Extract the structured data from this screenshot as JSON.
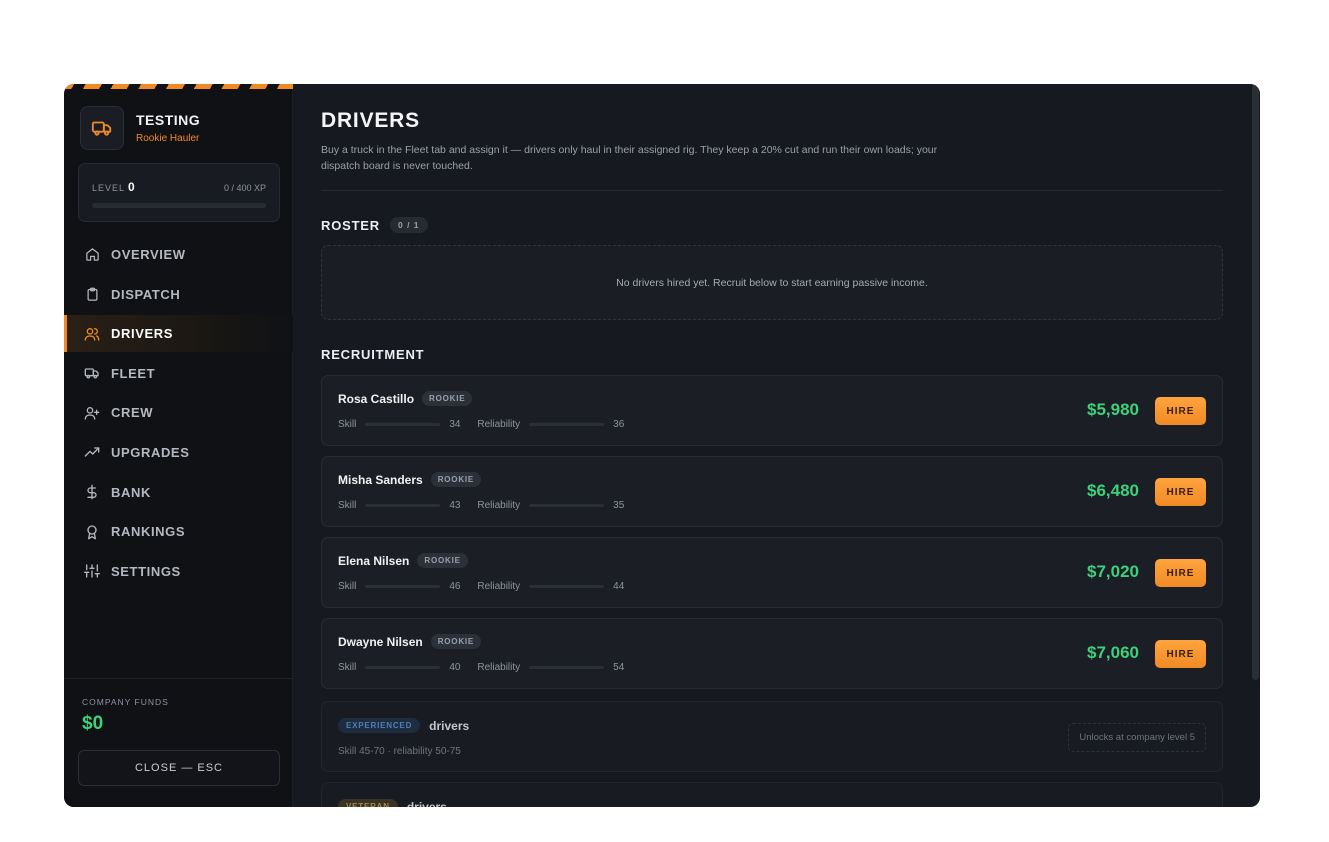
{
  "company": {
    "name": "TESTING",
    "rank": "Rookie Hauler"
  },
  "level": {
    "label": "LEVEL",
    "value": "0",
    "xp": "0 / 400 XP",
    "progress": 0
  },
  "nav": [
    {
      "label": "OVERVIEW",
      "icon": "home-icon",
      "active": false
    },
    {
      "label": "DISPATCH",
      "icon": "clipboard-icon",
      "active": false
    },
    {
      "label": "DRIVERS",
      "icon": "users-icon",
      "active": true
    },
    {
      "label": "FLEET",
      "icon": "truck-icon",
      "active": false
    },
    {
      "label": "CREW",
      "icon": "user-plus-icon",
      "active": false
    },
    {
      "label": "UPGRADES",
      "icon": "trending-up-icon",
      "active": false
    },
    {
      "label": "BANK",
      "icon": "dollar-icon",
      "active": false
    },
    {
      "label": "RANKINGS",
      "icon": "award-icon",
      "active": false
    },
    {
      "label": "SETTINGS",
      "icon": "sliders-icon",
      "active": false
    }
  ],
  "funds": {
    "label": "COMPANY FUNDS",
    "value": "$0"
  },
  "close_label": "CLOSE — ESC",
  "page": {
    "title": "DRIVERS",
    "description": "Buy a truck in the Fleet tab and assign it — drivers only haul in their assigned rig. They keep a 20% cut and run their own loads; your dispatch board is never touched."
  },
  "roster": {
    "title": "ROSTER",
    "count": "0 / 1",
    "empty_text": "No drivers hired yet. Recruit below to start earning passive income."
  },
  "recruitment": {
    "title": "RECRUITMENT",
    "skill_label": "Skill",
    "reliability_label": "Reliability",
    "hire_label": "HIRE",
    "drivers": [
      {
        "name": "Rosa Castillo",
        "tier": "ROOKIE",
        "skill": 34,
        "reliability": 36,
        "price": "$5,980"
      },
      {
        "name": "Misha Sanders",
        "tier": "ROOKIE",
        "skill": 43,
        "reliability": 35,
        "price": "$6,480"
      },
      {
        "name": "Elena Nilsen",
        "tier": "ROOKIE",
        "skill": 46,
        "reliability": 44,
        "price": "$7,020"
      },
      {
        "name": "Dwayne Nilsen",
        "tier": "ROOKIE",
        "skill": 40,
        "reliability": 54,
        "price": "$7,060"
      }
    ],
    "locked": [
      {
        "tier": "EXPERIENCED",
        "word": "drivers",
        "sub": "Skill 45-70 · reliability 50-75",
        "unlock": "Unlocks at company level 5"
      },
      {
        "tier": "VETERAN",
        "word": "drivers"
      }
    ]
  },
  "colors": {
    "accent": "#f08a24",
    "money": "#3dd17a",
    "background": "#16191f",
    "sidebar": "#0f1115"
  }
}
